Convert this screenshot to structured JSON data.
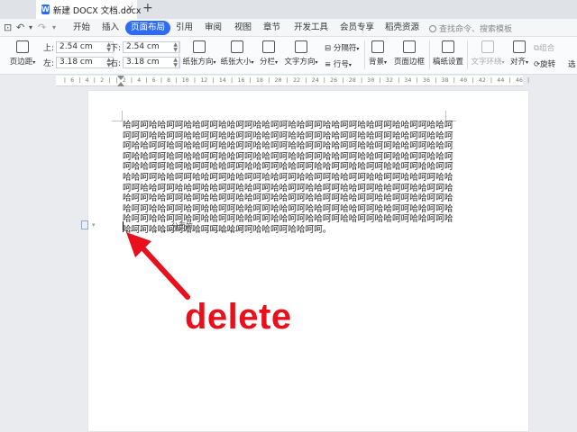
{
  "titlebar": {
    "doc_tab": "新建 DOCX 文档.docx",
    "doc_icon": "W",
    "close": "×",
    "new_tab": "+"
  },
  "menu": {
    "quick_icons": [
      "document-icon",
      "undo-icon",
      "redo-icon",
      "chevron-down-icon"
    ],
    "more": "≡",
    "tabs": [
      "开始",
      "插入",
      "页面布局",
      "引用",
      "审阅",
      "视图",
      "章节",
      "开发工具",
      "会员专享",
      "稻壳资源"
    ],
    "active_tab": "页面布局",
    "search_placeholder": "查找命令、搜索模板"
  },
  "ribbon": {
    "margins_label": "页边距",
    "top_label": "上:",
    "top_value": "2.54 cm",
    "bottom_label": "下:",
    "bottom_value": "2.54 cm",
    "left_label": "左:",
    "left_value": "3.18 cm",
    "right_label": "右:",
    "right_value": "3.18 cm",
    "orientation": "纸张方向",
    "size": "纸张大小",
    "columns": "分栏",
    "text_direction": "文字方向",
    "separator": "分隔符",
    "line_number": "行号",
    "background": "背景",
    "page_border": "页面边框",
    "paper_settings": "稿纸设置",
    "text_wrap": "文字环绕",
    "align": "对齐",
    "group": "组合",
    "rotate": "旋转",
    "select": "选"
  },
  "ruler": {
    "numbers": "| 6 |  4 |  2 |    | 2 |  4 |  6 |  8 | 10 | 12 | 14 | 16 | 18 | 20 | 22 | 24 | 26 | 28 | 30 | 32 | 34 | 36 | 38 | 40 | 42 | 44 | 46 |"
  },
  "document": {
    "body_text": "哈呵呵哈哈呵呵哈哈呵呵哈哈呵呵哈哈呵呵哈哈呵呵哈哈呵呵哈哈呵呵哈哈呵呵哈哈呵呵呵呵哈哈呵呵哈哈呵呵哈哈呵呵哈哈呵呵哈哈呵呵哈哈呵呵哈哈呵呵哈哈呵呵哈哈呵呵哈哈呵呵哈呵哈哈呵呵哈哈呵呵哈哈呵呵哈哈呵呵哈哈呵呵哈哈呵呵哈哈呵呵哈哈呵呵哈哈呵呵哈呵哈哈呵呵哈哈呵呵哈哈呵呵哈哈呵呵哈哈呵呵哈哈呵呵哈哈呵呵哈哈呵呵哈哈呵呵哈呵哈呵呵哈哈呵呵哈哈呵呵哈哈呵呵哈哈呵呵哈哈呵呵哈哈呵呵哈哈呵呵哈哈呵呵哈哈呵呵哈哈呵呵哈哈呵呵哈哈呵呵哈哈呵呵哈哈呵呵哈哈呵呵哈哈呵呵哈哈呵呵哈哈呵呵哈哈呵哈哈呵呵哈哈呵呵哈哈呵呵哈哈呵呵哈哈呵呵哈哈呵呵哈哈呵呵哈哈呵呵哈哈呵呵哈呵哈哈呵呵哈哈呵呵哈哈呵呵哈哈呵呵哈哈呵呵哈哈呵呵哈哈呵呵哈哈呵呵哈哈呵呵哈呵哈哈呵呵哈哈呵呵哈哈呵呵哈哈呵呵哈哈呵呵哈哈呵呵哈哈呵呵哈哈呵呵哈哈呵呵哈呵哈哈呵呵哈哈呵呵哈哈呵呵哈哈呵呵哈哈呵呵哈哈呵呵哈哈呵呵哈哈呵呵哈哈呵呵哈哈呵呵哈哈呵呵哈哈呵呵哈哈呵呵。",
    "page_break_label": "分页符",
    "paragraph_mark": "↵"
  },
  "annotation": {
    "text": "delete",
    "color": "#e8101c"
  },
  "colors": {
    "accent": "#2f6cf6",
    "annotation_red": "#e8101c"
  }
}
